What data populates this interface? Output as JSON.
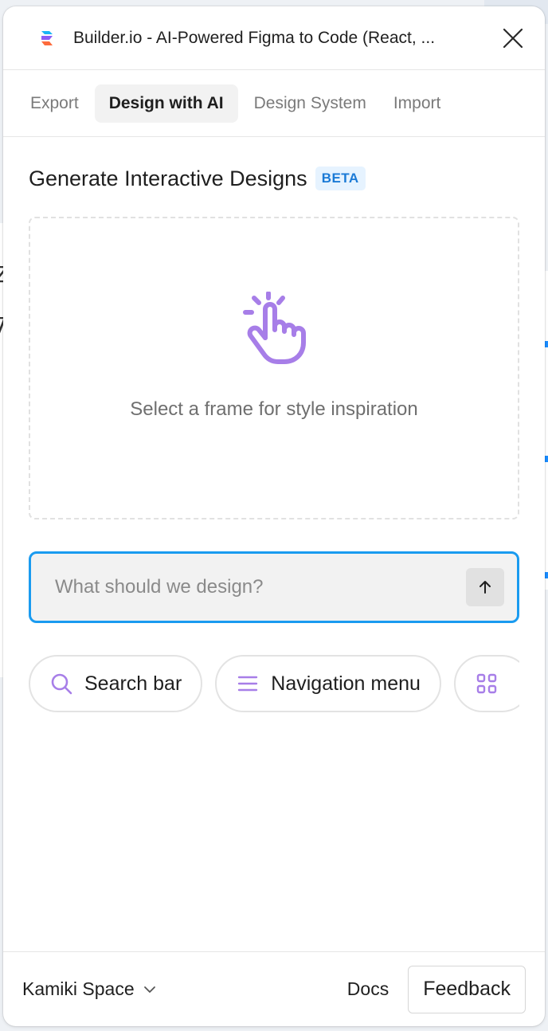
{
  "window": {
    "title": "Builder.io - AI-Powered Figma to Code (React, ...",
    "close_icon": "close-icon",
    "logo_icon": "builder-logo-icon"
  },
  "tabs": [
    {
      "label": "Export",
      "active": false
    },
    {
      "label": "Design with AI",
      "active": true
    },
    {
      "label": "Design System",
      "active": false
    },
    {
      "label": "Import",
      "active": false
    }
  ],
  "main": {
    "heading": "Generate Interactive Designs",
    "badge": "BETA",
    "dropzone": {
      "icon": "tap-hand-icon",
      "text": "Select a frame for style inspiration"
    },
    "prompt": {
      "placeholder": "What should we design?",
      "value": "",
      "send_icon": "arrow-up-icon"
    },
    "suggestions": [
      {
        "label": "Search bar",
        "icon": "search-icon"
      },
      {
        "label": "Navigation menu",
        "icon": "menu-icon"
      },
      {
        "label": "",
        "icon": "grid-icon"
      }
    ]
  },
  "footer": {
    "workspace": "Kamiki Space",
    "workspace_icon": "chevron-down-icon",
    "docs": "Docs",
    "feedback": "Feedback"
  },
  "colors": {
    "accent": "#1a9bf0",
    "icon_purple": "#a77ee8",
    "badge_bg": "#e6f3ff",
    "badge_text": "#1a7ad6"
  }
}
